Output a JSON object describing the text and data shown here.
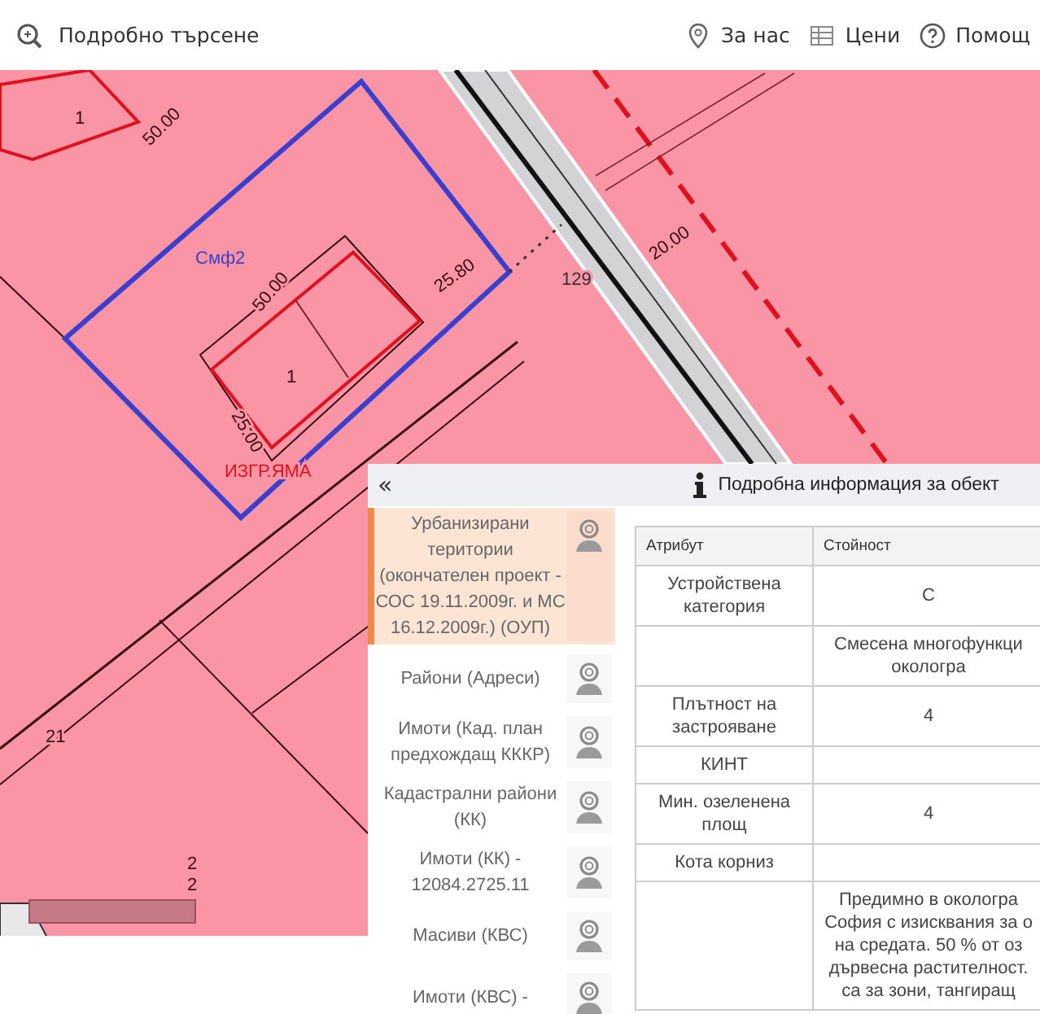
{
  "top_bar": {
    "search_link": "Подробно търсене",
    "links": [
      {
        "kind": "pin",
        "label": "За нас"
      },
      {
        "kind": "table",
        "label": "Цени"
      },
      {
        "kind": "help",
        "label": "Помощ"
      }
    ]
  },
  "map": {
    "labels": [
      "1",
      "50.00",
      "1",
      "50.00",
      "25.80",
      "25.00",
      "ИЗГР.ЯМА",
      "Смф2",
      "20.00",
      "129",
      "21",
      "2",
      "2"
    ]
  },
  "info_panel": {
    "collapse": "«",
    "title": "Подробна информация за обект",
    "layers": [
      {
        "label": "Урбанизирани територии (окончателен проект - СОС 19.11.2009г. и МС 16.12.2009г.) (ОУП)",
        "selected": true
      },
      {
        "label": "Райони (Адреси)",
        "selected": false
      },
      {
        "label": "Имоти (Кад. план предхождащ КККР)",
        "selected": false
      },
      {
        "label": "Кадастрални райони (КК)",
        "selected": false
      },
      {
        "label": "Имоти (КК) - 12084.2725.11",
        "selected": false
      },
      {
        "label": "Масиви (КВС)",
        "selected": false
      },
      {
        "label": "Имоти (КВС) -",
        "selected": false
      }
    ],
    "table": {
      "columns": [
        "Атрибут",
        "Стойност"
      ],
      "rows": [
        {
          "attribute": "Устройствена категория",
          "value": [
            "С"
          ]
        },
        {
          "value": [
            "Смесена многофункци",
            "окологра"
          ]
        },
        {
          "attribute": "Плътност на застрояване",
          "value": [
            "4"
          ]
        },
        {
          "attribute": "КИНТ"
        },
        {
          "attribute": "Мин. озеленена площ",
          "value": [
            "4"
          ]
        },
        {
          "attribute": "Кота корниз"
        },
        {
          "value": [
            "Предимно в окологра",
            "София с изисквания за о",
            "на средата. 50 % от оз",
            "дървесна растителност.",
            "са за зони, тангиращ"
          ]
        }
      ]
    }
  }
}
